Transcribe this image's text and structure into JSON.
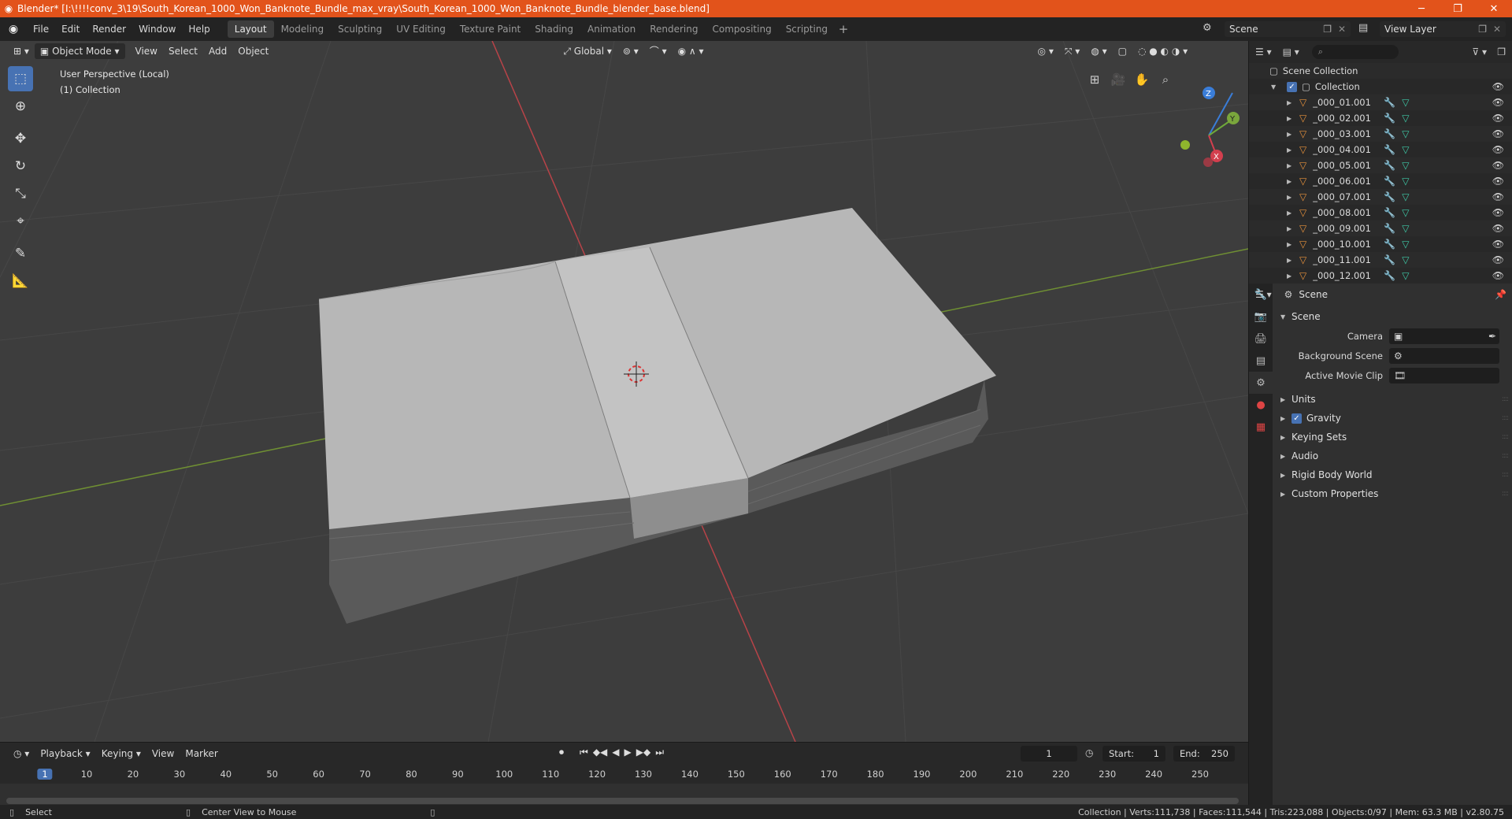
{
  "window": {
    "title": "Blender* [I:\\!!!!conv_3\\19\\South_Korean_1000_Won_Banknote_Bundle_max_vray\\South_Korean_1000_Won_Banknote_Bundle_blender_base.blend]",
    "accent_color": "#e2531b"
  },
  "menu": [
    "File",
    "Edit",
    "Render",
    "Window",
    "Help"
  ],
  "workspaces": [
    "Layout",
    "Modeling",
    "Sculpting",
    "UV Editing",
    "Texture Paint",
    "Shading",
    "Animation",
    "Rendering",
    "Compositing",
    "Scripting"
  ],
  "active_workspace": "Layout",
  "scene_name": "Scene",
  "view_layer": "View Layer",
  "viewport": {
    "mode": "Object Mode",
    "menus": [
      "View",
      "Select",
      "Add",
      "Object"
    ],
    "orientation": "Global",
    "info_line1": "User Perspective (Local)",
    "info_line2": "(1) Collection",
    "gizmo": {
      "x": "X",
      "y": "Y",
      "z": "Z"
    }
  },
  "tools": [
    "select-box",
    "cursor",
    "move",
    "rotate",
    "scale",
    "transform",
    "annotate",
    "measure"
  ],
  "outliner": {
    "root": "Scene Collection",
    "collection": "Collection",
    "objects": [
      "_000_01.001",
      "_000_02.001",
      "_000_03.001",
      "_000_04.001",
      "_000_05.001",
      "_000_06.001",
      "_000_07.001",
      "_000_08.001",
      "_000_09.001",
      "_000_10.001",
      "_000_11.001",
      "_000_12.001"
    ]
  },
  "properties": {
    "header": "Scene",
    "panel_title": "Scene",
    "fields": [
      {
        "label": "Camera",
        "value": ""
      },
      {
        "label": "Background Scene",
        "value": ""
      },
      {
        "label": "Active Movie Clip",
        "value": ""
      }
    ],
    "subpanels": [
      "Units",
      "Gravity",
      "Keying Sets",
      "Audio",
      "Rigid Body World",
      "Custom Properties"
    ],
    "gravity_checked": true
  },
  "timeline": {
    "menus": [
      "Playback",
      "Keying",
      "View",
      "Marker"
    ],
    "current_frame": "1",
    "start_label": "Start:",
    "start": "1",
    "end_label": "End:",
    "end": "250",
    "ruler": [
      "1",
      "10",
      "20",
      "30",
      "40",
      "50",
      "60",
      "70",
      "80",
      "90",
      "100",
      "110",
      "120",
      "130",
      "140",
      "150",
      "160",
      "170",
      "180",
      "190",
      "200",
      "210",
      "220",
      "230",
      "240",
      "250"
    ]
  },
  "status": {
    "left_action": "Select",
    "middle_action": "Center View to Mouse",
    "stats": "Collection | Verts:111,738 | Faces:111,544 | Tris:223,088 | Objects:0/97 | Mem: 63.3 MB | v2.80.75"
  }
}
